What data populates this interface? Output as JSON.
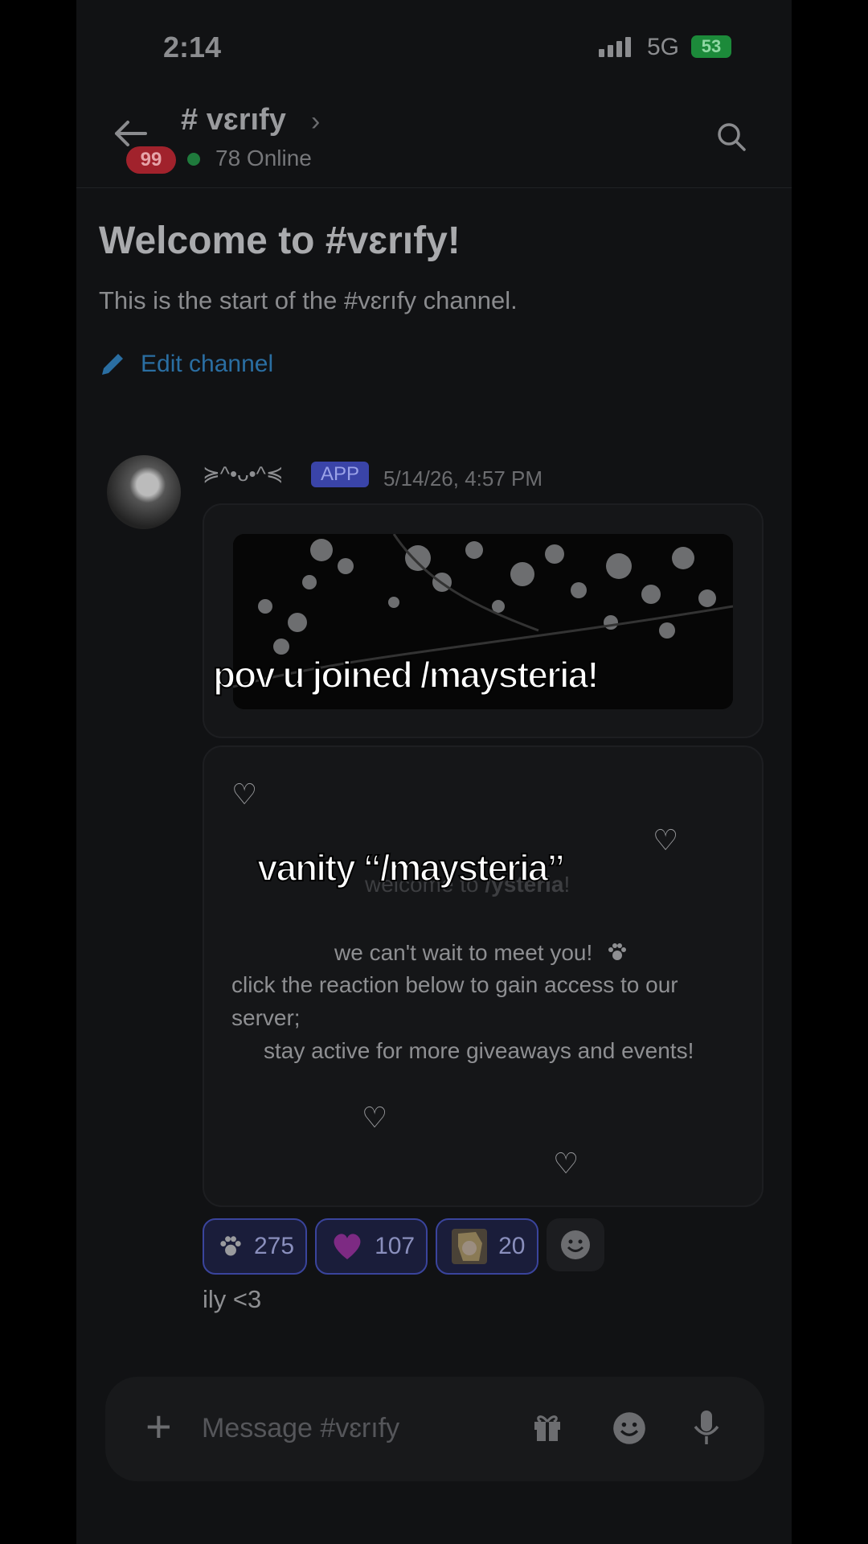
{
  "status_bar": {
    "time": "2:14",
    "network": "5G",
    "battery": "53"
  },
  "header": {
    "unread_badge": "99",
    "channel": "# vɛrıfy",
    "online": "78 Online"
  },
  "intro": {
    "title": "Welcome to #vɛrıfy!",
    "subtitle": "This is the start of the #vɛrıfy channel.",
    "edit_label": "Edit channel"
  },
  "message": {
    "author": "≽^•ᴗ•^≼",
    "app_badge": "APP",
    "timestamp": "5/14/26, 4:57 PM",
    "embed_text": {
      "line1_prefix": "welcome to ",
      "line1_bold": "/ysteria",
      "line1_suffix": "!",
      "line2": "we can't wait to meet you!",
      "line3": "click the reaction below to gain access to our",
      "line4": "server;",
      "line5": "stay active for more giveaways and events!"
    },
    "reactions": [
      {
        "emoji": "paw",
        "count": "275"
      },
      {
        "emoji": "purple-heart",
        "count": "107"
      },
      {
        "emoji": "anime-character",
        "count": "20"
      }
    ],
    "reply": "ily <3"
  },
  "composer": {
    "placeholder": "Message #vɛrıfy"
  },
  "overlays": {
    "caption1": "pov u joined /maysteria!",
    "caption2": "vanity “/maysteria”"
  },
  "icons": [
    "back-arrow-icon",
    "search-icon",
    "pencil-icon",
    "paw-icon",
    "heart-icon",
    "add-reaction-icon",
    "plus-icon",
    "gift-icon",
    "emoji-icon",
    "mic-icon"
  ]
}
